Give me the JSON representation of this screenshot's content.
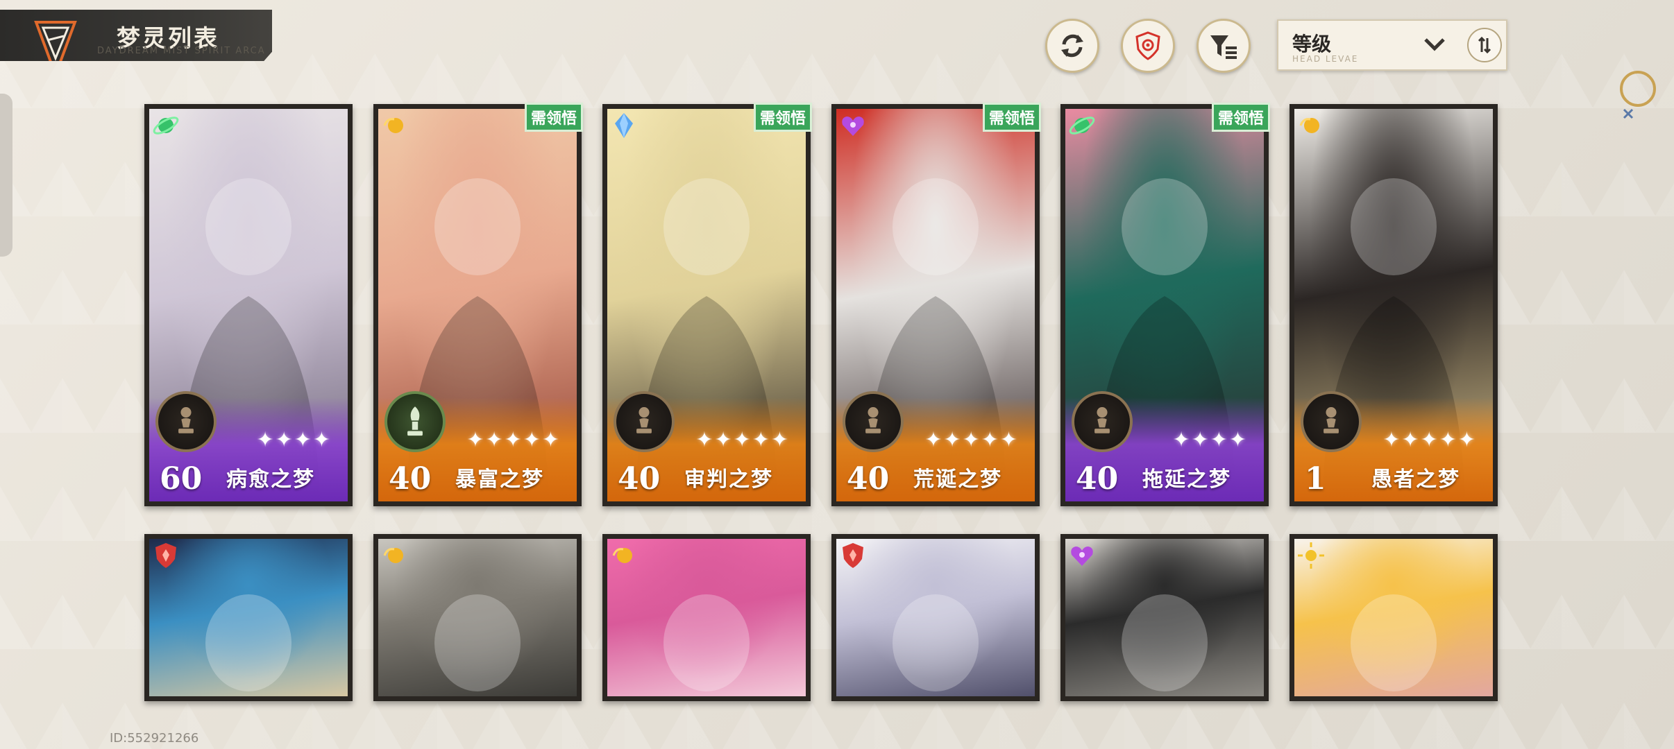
{
  "header": {
    "title": "梦灵列表",
    "subtitle": "DAYDREAM MIST SPIRIT ARCA"
  },
  "toolbar": {
    "refresh_icon": "refresh-icon",
    "shield_icon": "shield-target-icon",
    "filter_icon": "filter-icon",
    "sort_label": "等级",
    "sort_sub": "HEAD LEVAE",
    "sort_dropdown_icon": "chevron-down-icon",
    "sort_direction_icon": "sort-direction-icon"
  },
  "colors": {
    "purple_rarity": "#7b35c4",
    "orange_rarity": "#e27818",
    "need_tag": "#3aa55a",
    "card_frame": "#2a2622"
  },
  "cards": [
    {
      "level": "60",
      "name": "病愈之梦",
      "stars": "✦✦✦✦",
      "rarity": "purple",
      "element_icon": "green-orb-icon",
      "need_tag": "",
      "badge": "pawn-icon",
      "art": [
        "#e9e4e6",
        "#cfc6d6",
        "#6b6077"
      ]
    },
    {
      "level": "40",
      "name": "暴富之梦",
      "stars": "✦✦✦✦✦",
      "rarity": "orange",
      "element_icon": "gold-orb-icon",
      "need_tag": "需领悟",
      "badge": "bishop-icon",
      "art": [
        "#f0c9a8",
        "#e8a98f",
        "#8c3b2c"
      ]
    },
    {
      "level": "40",
      "name": "审判之梦",
      "stars": "✦✦✦✦✦",
      "rarity": "orange",
      "element_icon": "blue-crystal-icon",
      "need_tag": "需领悟",
      "badge": "pawn-icon",
      "art": [
        "#f3e6b2",
        "#e1d29a",
        "#2d2520"
      ]
    },
    {
      "level": "40",
      "name": "荒诞之梦",
      "stars": "✦✦✦✦✦",
      "rarity": "orange",
      "element_icon": "purple-heart-icon",
      "need_tag": "需领悟",
      "badge": "pawn-icon",
      "art": [
        "#cf2d23",
        "#e5e2df",
        "#2a1d1e"
      ]
    },
    {
      "level": "40",
      "name": "拖延之梦",
      "stars": "✦✦✦✦",
      "rarity": "purple",
      "element_icon": "green-orb-icon",
      "need_tag": "需领悟",
      "badge": "pawn-icon",
      "art": [
        "#e98ba1",
        "#1f6a5c",
        "#2c2a2a"
      ]
    },
    {
      "level": "1",
      "name": "愚者之梦",
      "stars": "✦✦✦✦✦",
      "rarity": "orange",
      "element_icon": "gold-orb-icon",
      "need_tag": "",
      "badge": "pawn-icon",
      "art": [
        "#f1eee9",
        "#2b2624",
        "#d8c28c"
      ]
    }
  ],
  "row2": [
    {
      "element_icon": "red-shield-icon",
      "art": [
        "#1f2a4a",
        "#3b8fc2",
        "#d7c7a2"
      ]
    },
    {
      "element_icon": "gold-orb-icon",
      "art": [
        "#c9c6bf",
        "#7e7a72",
        "#3b3a36"
      ]
    },
    {
      "element_icon": "gold-orb-icon",
      "art": [
        "#f06cab",
        "#d95a9a",
        "#f3c9d9"
      ]
    },
    {
      "element_icon": "red-shield-icon",
      "art": [
        "#f5f4f6",
        "#c2c0d6",
        "#51506b"
      ]
    },
    {
      "element_icon": "purple-heart-icon",
      "art": [
        "#dcd8d2",
        "#2b2b2b",
        "#8c8983"
      ]
    },
    {
      "element_icon": "gold-sun-icon",
      "art": [
        "#f8f3ec",
        "#f6c24b",
        "#e2a7a0"
      ]
    }
  ],
  "footer": {
    "user_id": "ID:552921266"
  }
}
